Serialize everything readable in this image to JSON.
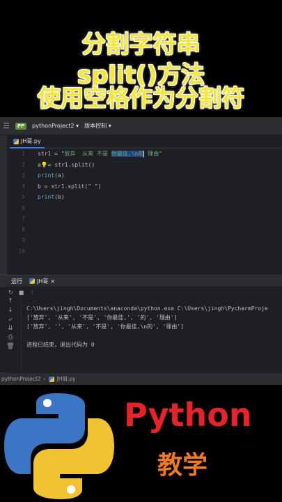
{
  "headlines": [
    "分割字符串",
    "split()方法",
    "使用空格作为分割符"
  ],
  "ide": {
    "project_name": "pythonProject2",
    "project_badge": "PP",
    "vcs_label": "版本控制",
    "file_tab": "JH哥.py",
    "line_numbers": [
      "1",
      "2",
      "3",
      "4",
      "5",
      "6",
      "7",
      "8",
      "9",
      "10"
    ],
    "code": {
      "line1_prefix": "str1 = \"",
      "line1_str": "放弃  从来 不是 ",
      "line1_sel": "你最佳,\\n的",
      "line1_tail": " 理由\"",
      "line2_a": "a",
      "line2_rest": "= str1.split()",
      "line3_fn": "print",
      "line3_rest": "(a)",
      "line4": "b = str1.split(\" \")",
      "line5_fn": "print",
      "line5_rest": "(b)"
    },
    "run_label": "运行",
    "run_tab": "JH哥",
    "console": [
      "C:\\Users\\jingh\\Documents\\anaconda\\python.exe C:\\Users\\jingh\\PycharmProje",
      "['放弃', '从来', '不是', '你最佳,', '的', '理由']",
      "['放弃', '', '从来', '不是', '你最佳,\\n的', '理由']",
      "",
      "进程已结束，退出代码为 0"
    ],
    "statusbar": {
      "project": "pythonProject2",
      "file": "JH哥.py"
    }
  },
  "brand": {
    "name": "Python",
    "subtitle": "教学"
  },
  "colors": {
    "headline": "#f5e63c",
    "brand_red": "#e6232b",
    "brand_orange": "#f07a1e",
    "python_blue": "#3a76c4",
    "python_yellow": "#f1c232"
  }
}
